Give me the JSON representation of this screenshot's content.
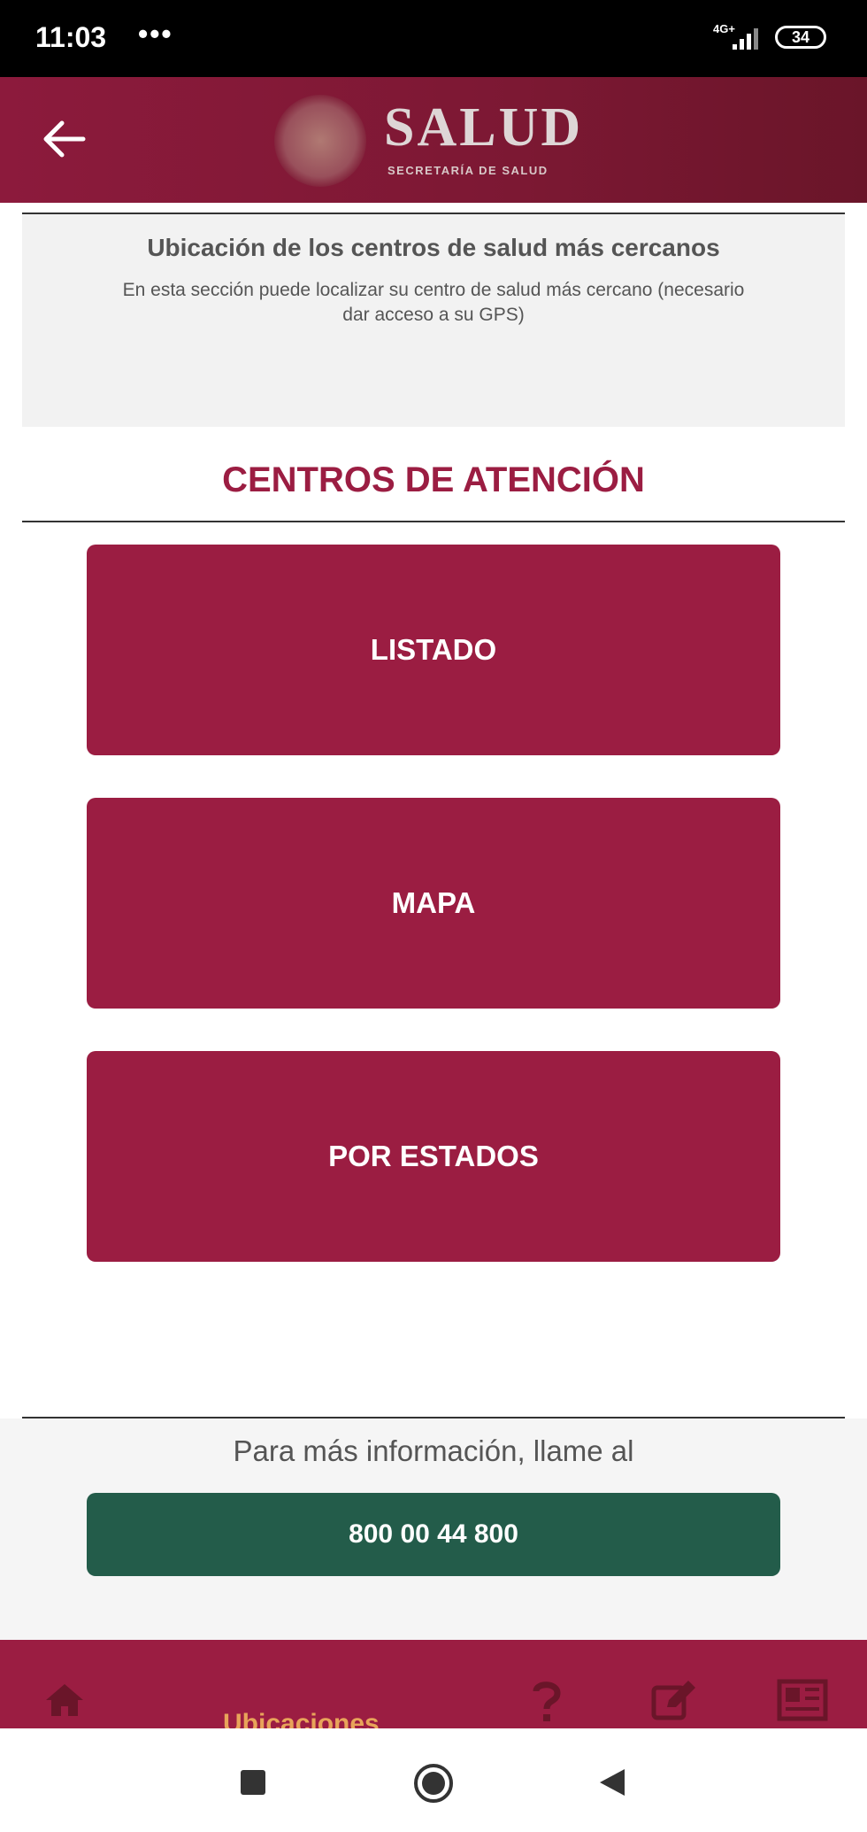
{
  "status_bar": {
    "time": "11:03",
    "overflow_dots": "•••",
    "network": "4G+",
    "battery": "34"
  },
  "app_bar": {
    "brand_title": "SALUD",
    "brand_subtitle": "SECRETARÍA DE SALUD"
  },
  "info": {
    "heading": "Ubicación de los centros de salud más cercanos",
    "description": "En esta sección puede localizar su centro de salud más cercano (necesario dar acceso a su GPS)"
  },
  "section": {
    "title": "CENTROS DE ATENCIÓN",
    "buttons": [
      "LISTADO",
      "MAPA",
      "POR ESTADOS"
    ]
  },
  "footer": {
    "info_text": "Para más información, llame al",
    "phone": "800 00 44 800"
  },
  "bottom_nav": {
    "active_label": "Ubicaciones"
  },
  "colors": {
    "primary": "#9b1d42",
    "appbar": "#7c1833",
    "phone_button": "#235c4a",
    "active_label": "#e8a45a"
  }
}
